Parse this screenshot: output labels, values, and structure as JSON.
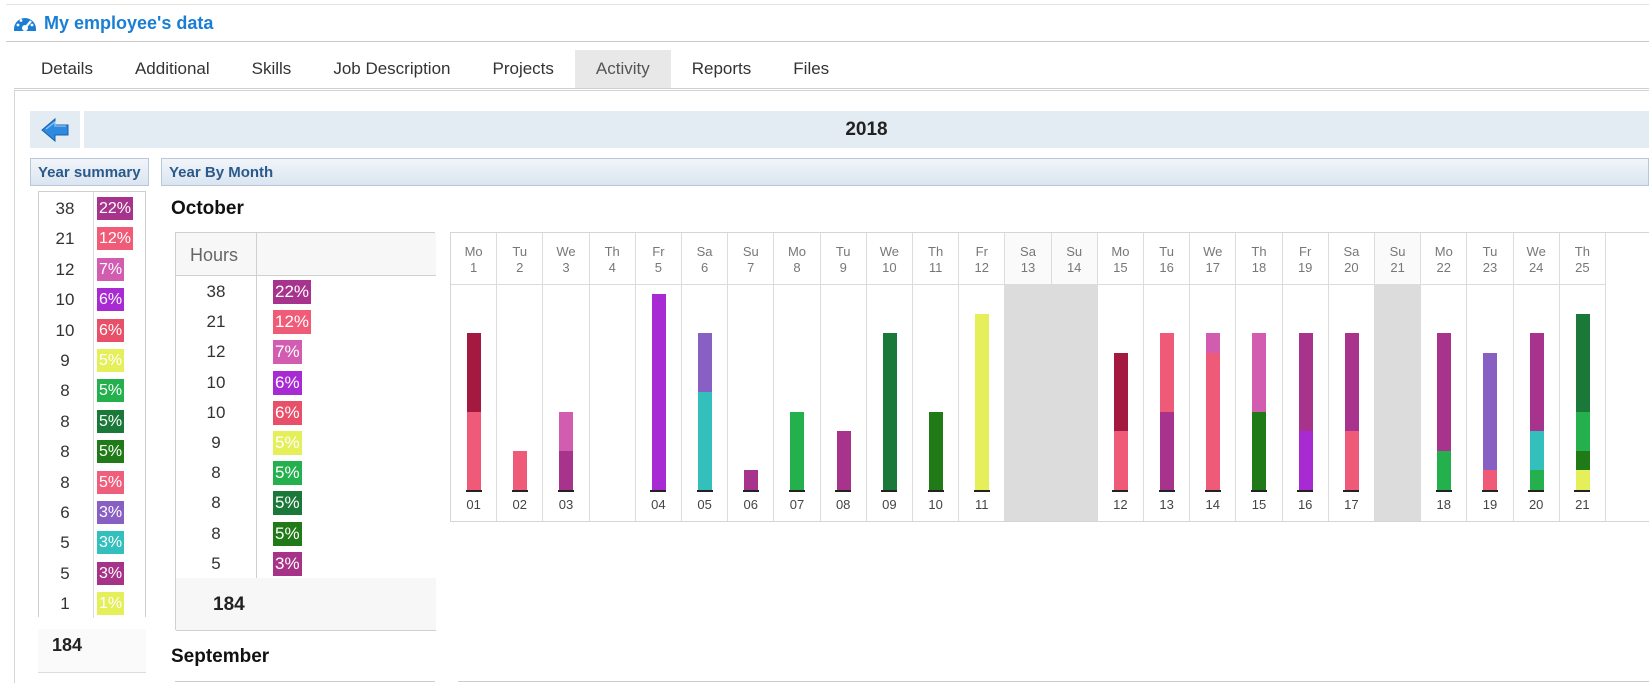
{
  "app": {
    "title": "My employee's data",
    "icon": "dashboard-gauge-icon"
  },
  "tabs": [
    {
      "label": "Details",
      "active": false
    },
    {
      "label": "Additional",
      "active": false
    },
    {
      "label": "Skills",
      "active": false
    },
    {
      "label": "Job Description",
      "active": false
    },
    {
      "label": "Projects",
      "active": false
    },
    {
      "label": "Activity",
      "active": true
    },
    {
      "label": "Reports",
      "active": false
    },
    {
      "label": "Files",
      "active": false
    }
  ],
  "year_nav": {
    "year": "2018",
    "back_icon": "back-arrow-icon"
  },
  "year_summary": {
    "header": "Year summary",
    "rows": [
      {
        "hours": "38",
        "pct": "22%",
        "color": "#a8338c"
      },
      {
        "hours": "21",
        "pct": "12%",
        "color": "#f05b78"
      },
      {
        "hours": "12",
        "pct": "7%",
        "color": "#d15cb0"
      },
      {
        "hours": "10",
        "pct": "6%",
        "color": "#a82ad3"
      },
      {
        "hours": "10",
        "pct": "6%",
        "color": "#e8506a"
      },
      {
        "hours": "9",
        "pct": "5%",
        "color": "#e4ef5a"
      },
      {
        "hours": "8",
        "pct": "5%",
        "color": "#23b04d"
      },
      {
        "hours": "8",
        "pct": "5%",
        "color": "#1a7838"
      },
      {
        "hours": "8",
        "pct": "5%",
        "color": "#1f7a17"
      },
      {
        "hours": "8",
        "pct": "5%",
        "color": "#ef5e7a"
      },
      {
        "hours": "6",
        "pct": "3%",
        "color": "#8860c4"
      },
      {
        "hours": "5",
        "pct": "3%",
        "color": "#33c0bd"
      },
      {
        "hours": "5",
        "pct": "3%",
        "color": "#a63387"
      },
      {
        "hours": "1",
        "pct": "1%",
        "color": "#e4ef5a"
      }
    ],
    "total": "184"
  },
  "year_by_month": {
    "header": "Year By Month",
    "october": {
      "title": "October",
      "hours_label": "Hours",
      "rows": [
        {
          "hours": "38",
          "pct": "22%",
          "color": "#a8338c"
        },
        {
          "hours": "21",
          "pct": "12%",
          "color": "#f05b78"
        },
        {
          "hours": "12",
          "pct": "7%",
          "color": "#d15cb0"
        },
        {
          "hours": "10",
          "pct": "6%",
          "color": "#a82ad3"
        },
        {
          "hours": "10",
          "pct": "6%",
          "color": "#e8506a"
        },
        {
          "hours": "9",
          "pct": "5%",
          "color": "#e4ef5a"
        },
        {
          "hours": "8",
          "pct": "5%",
          "color": "#23b04d"
        },
        {
          "hours": "8",
          "pct": "5%",
          "color": "#1a7838"
        },
        {
          "hours": "8",
          "pct": "5%",
          "color": "#1f7a17"
        },
        {
          "hours": "5",
          "pct": "3%",
          "color": "#a63387"
        }
      ],
      "total": "184"
    },
    "september": {
      "title": "September"
    },
    "calendar": {
      "days": [
        {
          "dn": "Mo",
          "dd": "1",
          "label": "01",
          "weekend": false,
          "segments": [
            {
              "h": 4,
              "color": "#ee5a78"
            },
            {
              "h": 4,
              "color": "#a3193f"
            }
          ]
        },
        {
          "dn": "Tu",
          "dd": "2",
          "label": "02",
          "weekend": false,
          "segments": [
            {
              "h": 2,
              "color": "#ee5a78"
            }
          ]
        },
        {
          "dn": "We",
          "dd": "3",
          "label": "03",
          "weekend": false,
          "segments": [
            {
              "h": 2,
              "color": "#a8338c"
            },
            {
              "h": 2,
              "color": "#d15cb0"
            }
          ]
        },
        {
          "dn": "Th",
          "dd": "4",
          "label": "",
          "weekend": false,
          "segments": []
        },
        {
          "dn": "Fr",
          "dd": "5",
          "label": "04",
          "weekend": false,
          "segments": [
            {
              "h": 10,
              "color": "#a82ad3"
            }
          ]
        },
        {
          "dn": "Sa",
          "dd": "6",
          "label": "05",
          "weekend": false,
          "segments": [
            {
              "h": 5,
              "color": "#33c0bd"
            },
            {
              "h": 3,
              "color": "#8860c4"
            }
          ]
        },
        {
          "dn": "Su",
          "dd": "7",
          "label": "06",
          "weekend": false,
          "segments": [
            {
              "h": 1,
              "color": "#a8338c"
            }
          ]
        },
        {
          "dn": "Mo",
          "dd": "8",
          "label": "07",
          "weekend": false,
          "segments": [
            {
              "h": 4,
              "color": "#23b04d"
            }
          ]
        },
        {
          "dn": "Tu",
          "dd": "9",
          "label": "08",
          "weekend": false,
          "segments": [
            {
              "h": 3,
              "color": "#a8338c"
            }
          ]
        },
        {
          "dn": "We",
          "dd": "10",
          "label": "09",
          "weekend": false,
          "segments": [
            {
              "h": 8,
              "color": "#1a7838"
            }
          ]
        },
        {
          "dn": "Th",
          "dd": "11",
          "label": "10",
          "weekend": false,
          "segments": [
            {
              "h": 4,
              "color": "#1f7a17"
            }
          ]
        },
        {
          "dn": "Fr",
          "dd": "12",
          "label": "11",
          "weekend": false,
          "segments": [
            {
              "h": 9,
              "color": "#e4ef5a"
            }
          ]
        },
        {
          "dn": "Sa",
          "dd": "13",
          "label": "",
          "weekend": true,
          "segments": []
        },
        {
          "dn": "Su",
          "dd": "14",
          "label": "",
          "weekend": true,
          "segments": []
        },
        {
          "dn": "Mo",
          "dd": "15",
          "label": "12",
          "weekend": false,
          "segments": [
            {
              "h": 3,
              "color": "#ee5a78"
            },
            {
              "h": 4,
              "color": "#a3193f"
            }
          ]
        },
        {
          "dn": "Tu",
          "dd": "16",
          "label": "13",
          "weekend": false,
          "segments": [
            {
              "h": 4,
              "color": "#a8338c"
            },
            {
              "h": 4,
              "color": "#ee5a78"
            }
          ]
        },
        {
          "dn": "We",
          "dd": "17",
          "label": "14",
          "weekend": false,
          "segments": [
            {
              "h": 7,
              "color": "#ee5a78"
            },
            {
              "h": 1,
              "color": "#d15cb0"
            }
          ]
        },
        {
          "dn": "Th",
          "dd": "18",
          "label": "15",
          "weekend": false,
          "segments": [
            {
              "h": 4,
              "color": "#1f7a17"
            },
            {
              "h": 4,
              "color": "#d15cb0"
            }
          ]
        },
        {
          "dn": "Fr",
          "dd": "19",
          "label": "16",
          "weekend": false,
          "segments": [
            {
              "h": 3,
              "color": "#a82ad3"
            },
            {
              "h": 5,
              "color": "#a8338c"
            }
          ]
        },
        {
          "dn": "Sa",
          "dd": "20",
          "label": "17",
          "weekend": false,
          "segments": [
            {
              "h": 3,
              "color": "#ee5a78"
            },
            {
              "h": 5,
              "color": "#a8338c"
            }
          ]
        },
        {
          "dn": "Su",
          "dd": "21",
          "label": "",
          "weekend": true,
          "segments": []
        },
        {
          "dn": "Mo",
          "dd": "22",
          "label": "18",
          "weekend": false,
          "segments": [
            {
              "h": 2,
              "color": "#23b04d"
            },
            {
              "h": 6,
              "color": "#a8338c"
            }
          ]
        },
        {
          "dn": "Tu",
          "dd": "23",
          "label": "19",
          "weekend": false,
          "segments": [
            {
              "h": 1,
              "color": "#ee5a78"
            },
            {
              "h": 6,
              "color": "#8860c4"
            }
          ]
        },
        {
          "dn": "We",
          "dd": "24",
          "label": "20",
          "weekend": false,
          "segments": [
            {
              "h": 1,
              "color": "#23b04d"
            },
            {
              "h": 2,
              "color": "#33c0bd"
            },
            {
              "h": 5,
              "color": "#a8338c"
            }
          ]
        },
        {
          "dn": "Th",
          "dd": "25",
          "label": "21",
          "weekend": false,
          "segments": [
            {
              "h": 1,
              "color": "#e4ef5a"
            },
            {
              "h": 1,
              "color": "#1f7a17"
            },
            {
              "h": 2,
              "color": "#23b04d"
            },
            {
              "h": 5,
              "color": "#1a7838"
            }
          ]
        }
      ]
    }
  }
}
